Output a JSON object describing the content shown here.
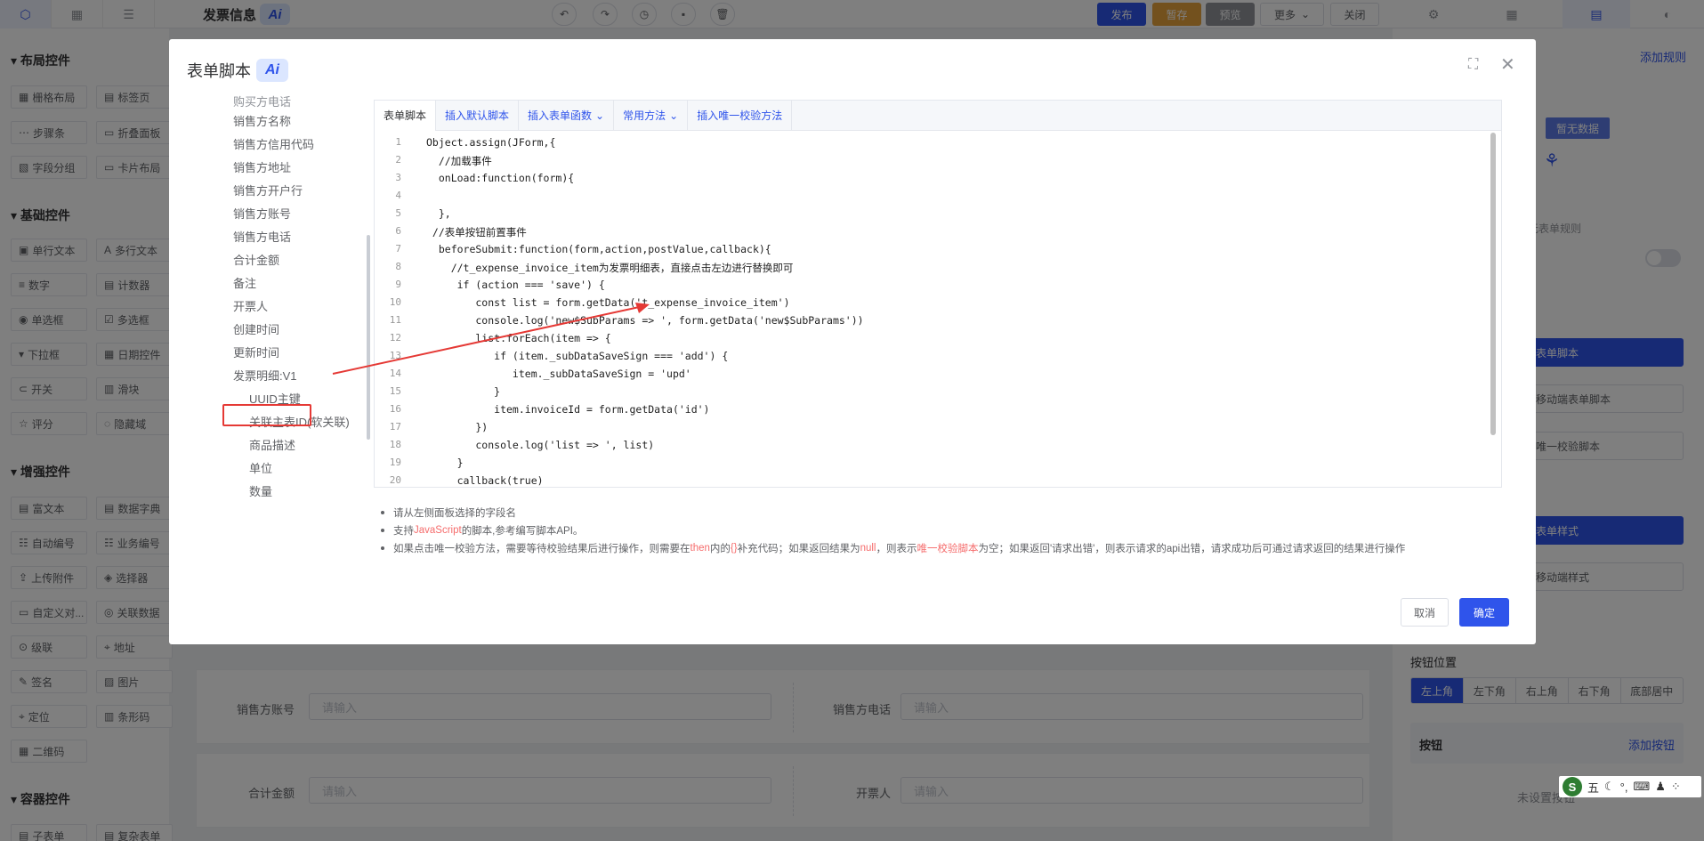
{
  "topbar": {
    "title": "发票信息",
    "ai": "Ai",
    "publish": "发布",
    "save_draft": "暂存",
    "preview": "预览",
    "more": "更多",
    "close": "关闭"
  },
  "left_panel": {
    "groups": [
      {
        "title": "布局控件",
        "items": [
          "栅格布局",
          "标签页",
          "步骤条",
          "折叠面板",
          "字段分组",
          "卡片布局"
        ]
      },
      {
        "title": "基础控件",
        "items": [
          "单行文本",
          "多行文本",
          "数字",
          "计数器",
          "单选框",
          "多选框",
          "下拉框",
          "日期控件",
          "开关",
          "滑块",
          "评分",
          "隐藏域"
        ]
      },
      {
        "title": "增强控件",
        "items": [
          "富文本",
          "数据字典",
          "自动编号",
          "业务编号",
          "上传附件",
          "选择器",
          "自定义对...",
          "关联数据",
          "级联",
          "地址",
          "签名",
          "图片",
          "定位",
          "条形码",
          "二维码"
        ]
      },
      {
        "title": "容器控件",
        "items": [
          "子表单",
          "复杂表单"
        ]
      }
    ]
  },
  "canvas": {
    "rows": [
      {
        "left_label": "销售方账号",
        "left_placeholder": "请输入",
        "right_label": "销售方电话",
        "right_placeholder": "请输入"
      },
      {
        "left_label": "合计金额",
        "left_placeholder": "请输入",
        "right_label": "开票人",
        "right_placeholder": "请输入"
      }
    ]
  },
  "right_panel": {
    "add_rule": "添加规则",
    "empty_badge": "暂无数据",
    "empty_text": "暂无表单规则",
    "btn_form_script": "表单脚本",
    "btn_mobile_script": "移动端表单脚本",
    "btn_validate_script": "唯一校验脚本",
    "btn_form_style": "表单样式",
    "btn_mobile_style": "移动端样式",
    "btn_position_label": "按钮位置",
    "positions": [
      "左上角",
      "左下角",
      "右上角",
      "右下角",
      "底部居中"
    ],
    "buttons_label": "按钮",
    "add_button": "添加按钮",
    "no_button": "未设置按钮"
  },
  "ime": {
    "label": "五"
  },
  "dialog": {
    "title": "表单脚本",
    "ai": "Ai",
    "tree": {
      "partial_top": "购买方电话",
      "fields": [
        "销售方名称",
        "销售方信用代码",
        "销售方地址",
        "销售方开户行",
        "销售方账号",
        "销售方电话",
        "合计金额",
        "备注",
        "开票人",
        "创建时间",
        "更新时间"
      ],
      "selected": "发票明细:V1",
      "children": [
        "UUID主键",
        "关联主表ID(软关联)",
        "商品描述",
        "单位",
        "数量"
      ]
    },
    "toolbar": {
      "tab_script": "表单脚本",
      "insert_default": "插入默认脚本",
      "insert_function": "插入表单函数",
      "common_methods": "常用方法",
      "insert_unique": "插入唯一校验方法"
    },
    "code_lines": [
      "Object.assign(JForm,{",
      "  //加载事件",
      "  onLoad:function(form){",
      "",
      "  },",
      " //表单按钮前置事件",
      "  beforeSubmit:function(form,action,postValue,callback){",
      "    //t_expense_invoice_item为发票明细表，直接点击左边进行替换即可",
      "     if (action === 'save') {",
      "        const list = form.getData('t_expense_invoice_item')",
      "        console.log('new$SubParams => ', form.getData('new$SubParams'))",
      "        list.forEach(item => {",
      "           if (item._subDataSaveSign === 'add') {",
      "              item._subDataSaveSign = 'upd'",
      "           }",
      "           item.invoiceId = form.getData('id')",
      "        })",
      "        console.log('list => ', list)",
      "     }",
      "     callback(true)"
    ],
    "notes": {
      "n1": "请从左侧面板选择的字段名",
      "n2_a": "支持",
      "n2_b": "JavaScript",
      "n2_c": "的脚本,参考编写脚本API。",
      "n3_a": "如果点击唯一校验方法，需要等待校验结果后进行操作，则需要在",
      "n3_b": "then",
      "n3_c": "内的",
      "n3_d": "{}",
      "n3_e": "补充代码；如果返回结果为",
      "n3_f": "null",
      "n3_g": "，则表示",
      "n3_h": "唯一校验脚本",
      "n3_i": "为空；如果返回'请求出错'，则表示请求的api出错，请求成功后可通过请求返回的结果进行操作"
    },
    "cancel": "取消",
    "confirm": "确定"
  }
}
